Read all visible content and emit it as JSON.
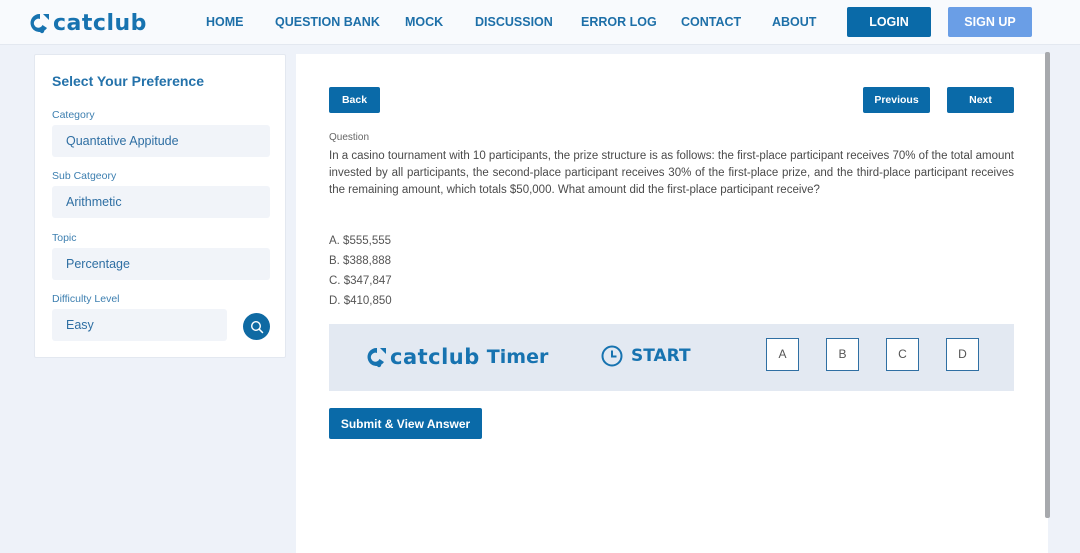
{
  "brand": {
    "name": "catclub",
    "primary_color": "#0a6aa8",
    "accent_color": "#1773b0",
    "signup_color": "#6a9ee6"
  },
  "nav": {
    "items": [
      {
        "label": "HOME"
      },
      {
        "label": "QUESTION BANK"
      },
      {
        "label": "MOCK"
      },
      {
        "label": "DISCUSSION"
      },
      {
        "label": "ERROR LOG"
      },
      {
        "label": "CONTACT"
      },
      {
        "label": "ABOUT"
      }
    ],
    "login_label": "LOGIN",
    "signup_label": "SIGN UP"
  },
  "sidebar": {
    "title": "Select Your Preference",
    "fields": [
      {
        "label": "Category",
        "value": "Quantative Appitude"
      },
      {
        "label": "Sub Catgeory",
        "value": "Arithmetic"
      },
      {
        "label": "Topic",
        "value": "Percentage"
      },
      {
        "label": "Difficulty Level",
        "value": "Easy"
      }
    ],
    "search_icon": "search-icon"
  },
  "main": {
    "back_label": "Back",
    "previous_label": "Previous",
    "next_label": "Next",
    "question_label": "Question",
    "question_text": "In a casino tournament with 10 participants, the prize structure is as follows: the first-place participant receives 70% of the total amount invested by all participants, the second-place participant receives 30% of the first-place prize, and the third-place participant receives the remaining amount, which totals $50,000. What amount did the first-place participant receive?",
    "options": [
      "A. $555,555",
      "B. $388,888",
      "C. $347,847",
      "D. $410,850"
    ],
    "timer": {
      "brand": "catclub",
      "title": "Timer",
      "start_label": "START",
      "clock_icon": "clock-icon",
      "answer_choices": [
        "A",
        "B",
        "C",
        "D"
      ]
    },
    "submit_label": "Submit & View Answer"
  }
}
